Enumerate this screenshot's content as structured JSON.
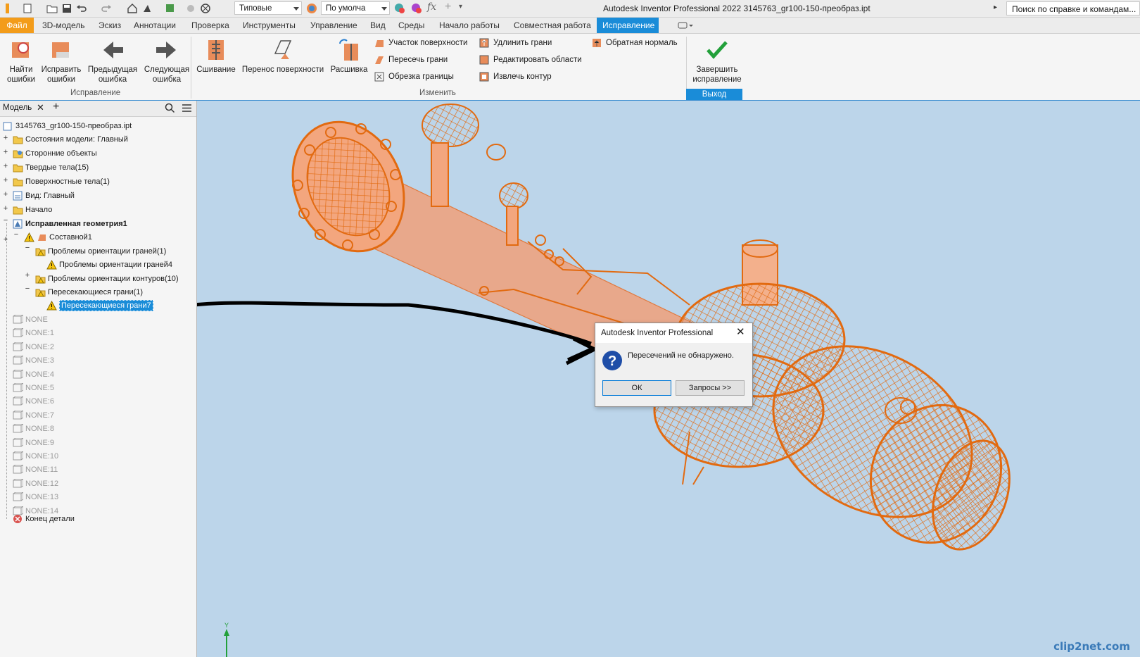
{
  "app": {
    "title": "Autodesk Inventor Professional 2022   3145763_gr100-150-преобраз.ipt",
    "search_placeholder": "Поиск по справке и командам...",
    "appearance_combo": "Типовые",
    "material_combo": "По умолча",
    "accent": "#f39c1a",
    "active_tab_color": "#1a8cd8"
  },
  "menu": {
    "file": "Файл",
    "tabs": [
      "3D-модель",
      "Эскиз",
      "Аннотации",
      "Проверка",
      "Инструменты",
      "Управление",
      "Вид",
      "Среды",
      "Начало работы",
      "Совместная работа",
      "Исправление"
    ],
    "active": "Исправление"
  },
  "ribbon": {
    "repair_group": {
      "label": "Исправление",
      "find": "Найти ошибки",
      "fix": "Исправить ошибки",
      "prev": "Предыдущая ошибка",
      "next": "Следующая ошибка"
    },
    "modify_group": {
      "label": "Изменить",
      "stitch": "Сшивание",
      "transfer": "Перенос поверхности",
      "unstitch": "Расшивка",
      "items": [
        "Участок поверхности",
        "Пересечь грани",
        "Обрезка границы",
        "Удлинить грани",
        "Редактировать области",
        "Извлечь контур",
        "Обратная нормаль"
      ]
    },
    "exit_group": {
      "label": "Выход",
      "finish": "Завершить исправление"
    }
  },
  "browser": {
    "tab": "Модель",
    "tree": [
      {
        "label": "3145763_gr100-150-преобраз.ipt",
        "level": 0
      },
      {
        "label": "Состояния модели: Главный",
        "level": 1
      },
      {
        "label": "Сторонние объекты",
        "level": 1
      },
      {
        "label": "Твердые тела(15)",
        "level": 1
      },
      {
        "label": "Поверхностные тела(1)",
        "level": 1
      },
      {
        "label": "Вид: Главный",
        "level": 1
      },
      {
        "label": "Начало",
        "level": 1
      },
      {
        "label": "Исправленная геометрия1",
        "level": 1
      },
      {
        "label": "Составной1",
        "level": 2
      },
      {
        "label": "Проблемы ориентации граней(1)",
        "level": 3
      },
      {
        "label": "Проблемы ориентации граней4",
        "level": 4
      },
      {
        "label": "Проблемы ориентации контуров(10)",
        "level": 3
      },
      {
        "label": "Пересекающиеся грани(1)",
        "level": 3
      },
      {
        "label": "Пересекающиеся грани7",
        "level": 4
      }
    ],
    "none_items": [
      "NONE",
      "NONE:1",
      "NONE:2",
      "NONE:3",
      "NONE:4",
      "NONE:5",
      "NONE:6",
      "NONE:7",
      "NONE:8",
      "NONE:9",
      "NONE:10",
      "NONE:11",
      "NONE:12",
      "NONE:13",
      "NONE:14"
    ],
    "end": "Конец детали"
  },
  "dialog": {
    "title": "Autodesk Inventor Professional",
    "message": "Пересечений не обнаружено.",
    "ok": "ОК",
    "queries": "Запросы >>"
  },
  "watermark": "clip2net.com"
}
